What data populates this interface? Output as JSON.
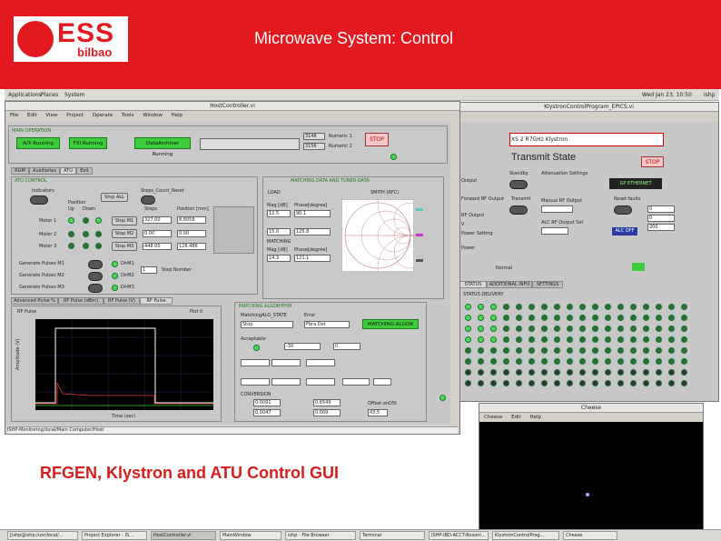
{
  "slide": {
    "title": "Microwave System: Control",
    "caption": "RFGEN, Klystron and ATU Control GUI"
  },
  "logo": {
    "text": "ESS",
    "subtext": "bilbao"
  },
  "gnome": {
    "menus": [
      "Applications",
      "Places",
      "System"
    ],
    "clock": "Wed Jan 23, 10:50",
    "user": "Ishp"
  },
  "host": {
    "title": "HostController.vi",
    "menus": [
      "File",
      "Edit",
      "View",
      "Project",
      "Operate",
      "Tools",
      "Window",
      "Help"
    ],
    "section_main": "MAIN OPERATION",
    "status_buttons": [
      "A/X Running",
      "FXI Running",
      "DataArchiver Running"
    ],
    "numeric1": "Numeric 1",
    "numeric2": "Numeric 2",
    "num1_val": "3148",
    "num2_val": "3156",
    "stop": "STOP",
    "tabs": [
      "RGM",
      "Auxiliaries",
      "ATU",
      "Exit"
    ],
    "atu_control": "ATU CONTROL",
    "indicators": "Indicators",
    "stop_all": "Stop ALL",
    "steps_count_reset": "Steps_Count_Reset",
    "position_label": "Position",
    "up": "Up",
    "down": "Down",
    "steps": "Steps",
    "position_mm": "Position [mm]",
    "motors": [
      "Motor 1",
      "Motor 2",
      "Motor 3"
    ],
    "stop_buttons": [
      "Stop M1",
      "Stop M2",
      "Stop M3"
    ],
    "steps_vals": [
      "327.00",
      "0.00",
      "448.00"
    ],
    "pos_vals": [
      "8.8058",
      "0.00",
      "128.486"
    ],
    "pulse_rows": [
      "Generate Pulses M1",
      "Generate Pulses M2",
      "Generate Pulses M3"
    ],
    "dir_labels": [
      "DirM1",
      "DirM2",
      "DirM3"
    ],
    "step_number": "Step Number",
    "step_val": "1",
    "tuner_title": "MATCHING DATA AND TUNER DATA",
    "load": "LOAD",
    "smith": "SMITH (RFC)",
    "mag": "Mag [dB]",
    "phase": "Phase[degree]",
    "load_mag": "12.5",
    "load_phase": "90.1",
    "r2_mag": "15.0",
    "r2_phase": "125.8",
    "matching": "MATCHING",
    "match_mag": "14.3",
    "match_phase": "121.1",
    "lower_tabs": [
      "Advanced Pulse %",
      "RF Pulse (dBm)",
      "RF Pulse (V)",
      "RF Pulse"
    ],
    "plot_title": "RF Pulse",
    "plot_legend": "Plot 0",
    "ylabel": "Amplitude (V)",
    "xlabel": "Time (sec)",
    "matching_alg": "MATCHING ALGORITHM",
    "matching_state": "MatchingALG_STATE",
    "state_val": "Stop",
    "error": "Error",
    "error_val": "Fbra Det",
    "match_btn": "MATCHING ALGOR",
    "acceptable": "Acceptable",
    "vswr_val": "-30",
    "freq_val": "0",
    "conversion": "CONVERSION",
    "conv1": "0.0091",
    "conv2": "0.0047",
    "conv3": "0.6549",
    "conv4": "0.009",
    "offset": "Offset-anD5t",
    "offset_val": "43.5",
    "status_path": "ISHP-Monitoring/local/Main Computer/Host"
  },
  "klystron": {
    "title": "KlystronControlProgram_EPICS.vi",
    "sub": "XS 2 R7GHz Klystron",
    "state": "Transmit State",
    "stop": "STOP",
    "standby": "Standby",
    "transmit": "Transmit",
    "attenuation": "Attenuation Settings",
    "eth": "GP ETHERNET",
    "manual_rf": "Manual RF Output",
    "reset_faults": "Reset faults",
    "left_labels": [
      "Output",
      "Forward RF Output",
      "RF Output",
      "V",
      "Power Setting",
      "Power"
    ],
    "alc_label": "ALC RF Output Set",
    "alc_btn": "ALC OFF",
    "tabs": [
      "STATUS",
      "ADDITIONAL INFO",
      "SETTINGS"
    ],
    "status_delivery": "STATUS DELIVERY",
    "right_vals": [
      "0",
      "0",
      "200"
    ],
    "footer": "Normal"
  },
  "cheese": {
    "title": "Cheese",
    "menus": [
      "Cheese",
      "Edit",
      "Help"
    ]
  },
  "taskbar": {
    "items": [
      "[ishp@ishp:/usr/local/...",
      "Project Explorer - IS...",
      "HostController.vi",
      "MainWindow",
      "ishp - File Browser",
      "Terminal",
      "ISHP-IBD-ACCT-Bosom...",
      "KlystronControlProg...",
      "Cheese"
    ]
  }
}
